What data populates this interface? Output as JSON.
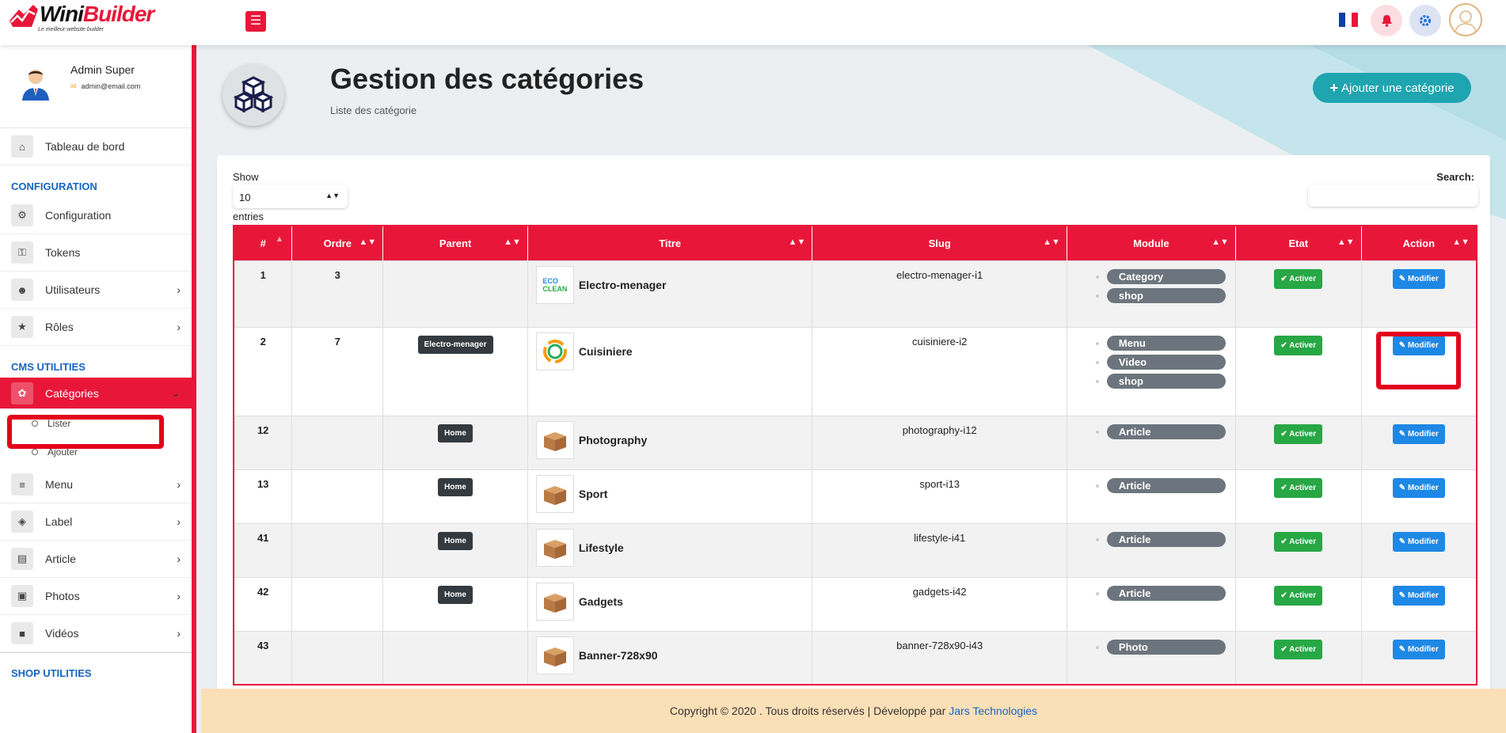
{
  "brand": {
    "logo_w": "Wini",
    "logo_b": "Builder",
    "tagline": "Le meilleur website builder"
  },
  "topbar": {
    "menu_icon": "hamburger-icon",
    "flag": "france-flag",
    "colors": {
      "flag_blue": "#0d3fa6",
      "flag_white": "#ffffff",
      "flag_red": "#e8173a"
    }
  },
  "user": {
    "name": "Admin Super",
    "email": "admin@email.com"
  },
  "sidebar": {
    "dashboard": "Tableau de bord",
    "section_config": "CONFIGURATION",
    "config_items": [
      "Configuration",
      "Tokens",
      "Utilisateurs",
      "Rôles"
    ],
    "section_cms": "CMS UTILITIES",
    "categories": "Catégories",
    "sub_list": "Lister",
    "sub_add": "Ajouter",
    "cms_items": [
      "Menu",
      "Label",
      "Article",
      "Photos",
      "Vidéos"
    ],
    "section_shop": "SHOP UTILITIES"
  },
  "header": {
    "title": "Gestion des catégories",
    "subtitle": "Liste des catégorie",
    "add_button": "Ajouter une catégorie"
  },
  "table_controls": {
    "show": "Show",
    "page_size": "10",
    "entries": "entries",
    "search": "Search:"
  },
  "columns": [
    "#",
    "Ordre",
    "Parent",
    "Titre",
    "Slug",
    "Module",
    "Etat",
    "Action"
  ],
  "rows": [
    {
      "id": "1",
      "ordre": "3",
      "parent": "",
      "titre": "Electro-menager",
      "slug": "electro-menager-i1",
      "modules": [
        "Category",
        "shop"
      ],
      "etat": "Activer",
      "action": "Modifier"
    },
    {
      "id": "2",
      "ordre": "7",
      "parent": "Electro-menager",
      "titre": "Cuisiniere",
      "slug": "cuisiniere-i2",
      "modules": [
        "Menu",
        "Video",
        "shop"
      ],
      "etat": "Activer",
      "action": "Modifier"
    },
    {
      "id": "12",
      "ordre": "",
      "parent": "Home",
      "titre": "Photography",
      "slug": "photography-i12",
      "modules": [
        "Article"
      ],
      "etat": "Activer",
      "action": "Modifier"
    },
    {
      "id": "13",
      "ordre": "",
      "parent": "Home",
      "titre": "Sport",
      "slug": "sport-i13",
      "modules": [
        "Article"
      ],
      "etat": "Activer",
      "action": "Modifier"
    },
    {
      "id": "41",
      "ordre": "",
      "parent": "Home",
      "titre": "Lifestyle",
      "slug": "lifestyle-i41",
      "modules": [
        "Article"
      ],
      "etat": "Activer",
      "action": "Modifier"
    },
    {
      "id": "42",
      "ordre": "",
      "parent": "Home",
      "titre": "Gadgets",
      "slug": "gadgets-i42",
      "modules": [
        "Article"
      ],
      "etat": "Activer",
      "action": "Modifier"
    },
    {
      "id": "43",
      "ordre": "",
      "parent": "",
      "titre": "Banner-728x90",
      "slug": "banner-728x90-i43",
      "modules": [
        "Photo"
      ],
      "etat": "Activer",
      "action": "Modifier"
    }
  ],
  "footer": {
    "text": "Copyright © 2020 . Tous droits réservés | Développé par",
    "link": "Jars Technologies"
  },
  "colors": {
    "accent": "#e8173a",
    "teal": "#1ea5b0",
    "success": "#28a745",
    "primary": "#1e88e5",
    "highlight": "#e4001b",
    "footer_bg": "#fbdfb7"
  }
}
